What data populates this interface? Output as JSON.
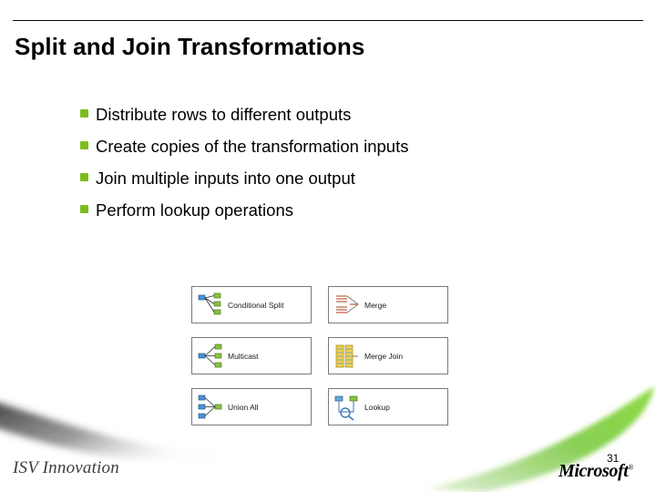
{
  "slide": {
    "title": "Split and Join Transformations",
    "bullets": [
      {
        "text": "Distribute rows to different outputs"
      },
      {
        "text": "Create copies of the transformation inputs"
      },
      {
        "text": "Join multiple inputs into one output"
      },
      {
        "text": "Perform lookup operations"
      }
    ],
    "components": [
      {
        "label": "Conditional Split",
        "icon": "conditional-split-icon"
      },
      {
        "label": "Merge",
        "icon": "merge-icon"
      },
      {
        "label": "Multicast",
        "icon": "multicast-icon"
      },
      {
        "label": "Merge Join",
        "icon": "merge-join-icon"
      },
      {
        "label": "Union All",
        "icon": "union-all-icon"
      },
      {
        "label": "Lookup",
        "icon": "lookup-icon"
      }
    ],
    "footer_left": "ISV Innovation",
    "slide_number": "31",
    "brand": "Microsoft",
    "brand_mark": "®",
    "colors": {
      "bullet_green": "#7bbd1e",
      "swoosh_green": "#65c11c",
      "rule": "#000000",
      "box_border": "#7a7a7a"
    }
  }
}
